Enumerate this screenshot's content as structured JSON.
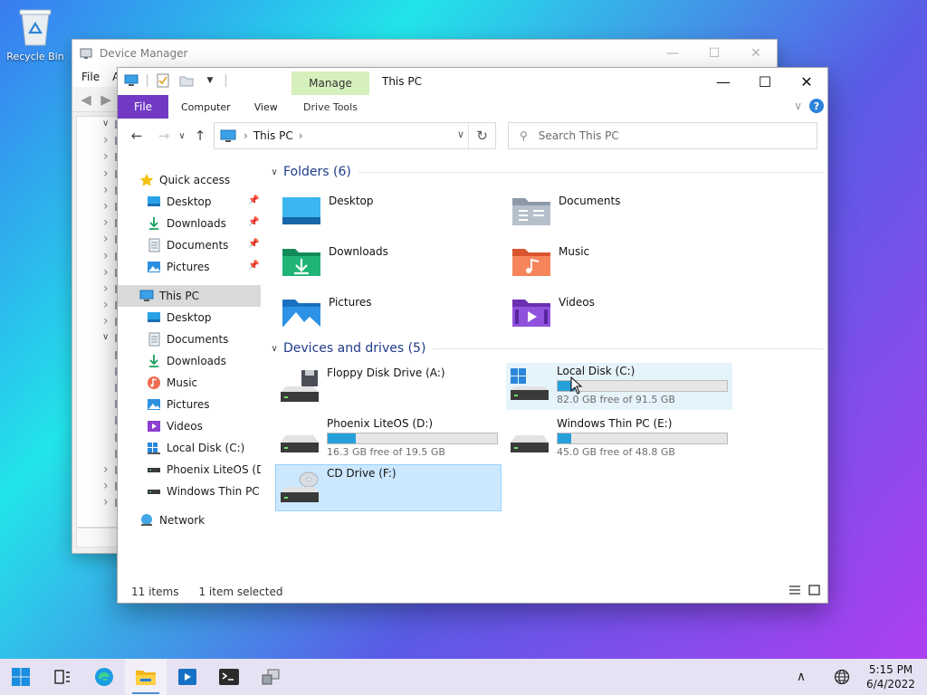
{
  "desktop": {
    "recycle_bin": "Recycle Bin"
  },
  "device_manager": {
    "title": "Device Manager",
    "menu": [
      "File",
      "A"
    ],
    "window_controls": [
      "—",
      "☐",
      "✕"
    ]
  },
  "explorer": {
    "title": "This PC",
    "manage_tab": "Manage",
    "context_tab": "Drive Tools",
    "ribbon_tabs": {
      "file": "File",
      "computer": "Computer",
      "view": "View"
    },
    "window_controls": [
      "—",
      "☐",
      "✕"
    ],
    "address": {
      "crumb": "This PC"
    },
    "search": {
      "placeholder": "Search This PC"
    },
    "nav": {
      "quick_access": "Quick access",
      "qa_desktop": "Desktop",
      "qa_downloads": "Downloads",
      "qa_documents": "Documents",
      "qa_pictures": "Pictures",
      "this_pc": "This PC",
      "pc_desktop": "Desktop",
      "pc_documents": "Documents",
      "pc_downloads": "Downloads",
      "pc_music": "Music",
      "pc_pictures": "Pictures",
      "pc_videos": "Videos",
      "pc_local_disk": "Local Disk (C:)",
      "pc_phoenix": "Phoenix LiteOS (D:)",
      "pc_thin": "Windows Thin PC (E:)",
      "network": "Network"
    },
    "folders_header": "Folders (6)",
    "folders": {
      "desktop": "Desktop",
      "documents": "Documents",
      "downloads": "Downloads",
      "music": "Music",
      "pictures": "Pictures",
      "videos": "Videos"
    },
    "drives_header": "Devices and drives (5)",
    "drives": {
      "floppy": {
        "name": "Floppy Disk Drive (A:)"
      },
      "c": {
        "name": "Local Disk (C:)",
        "free": "82.0 GB free of 91.5 GB",
        "used_fraction": 0.104
      },
      "d": {
        "name": "Phoenix LiteOS (D:)",
        "free": "16.3 GB free of 19.5 GB",
        "used_fraction": 0.164
      },
      "e": {
        "name": "Windows Thin PC (E:)",
        "free": "45.0 GB free of 48.8 GB",
        "used_fraction": 0.078
      },
      "cd": {
        "name": "CD Drive (F:)"
      }
    },
    "status": {
      "items": "11 items",
      "selected": "1 item selected"
    }
  },
  "taskbar": {
    "time": "5:15 PM",
    "date": "6/4/2022"
  }
}
